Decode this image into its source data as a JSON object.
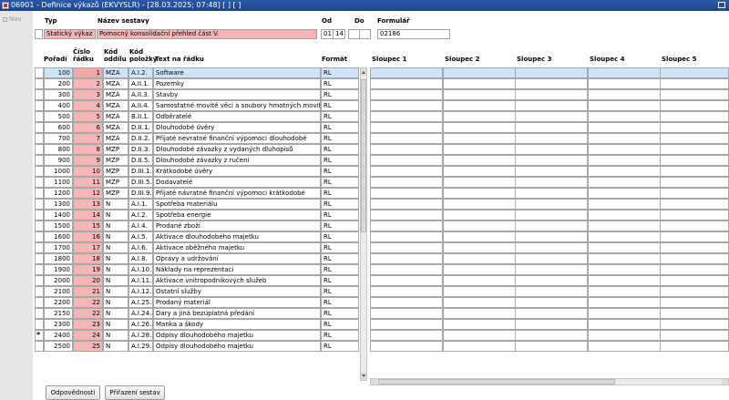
{
  "window": {
    "title": "06901 - Definice výkazů (EKVYSLR) - [28.03.2025; 07:48]  [ ]  [ ]"
  },
  "nav": {
    "label": "Nav"
  },
  "header": {
    "labels": {
      "typ": "Typ",
      "nazev": "Název sestavy",
      "od": "Od",
      "do": "Do",
      "formular": "Formulář"
    },
    "values": {
      "typ": "Statický výkaz",
      "nazev": "Pomocný konsolidační přehled část V.",
      "od_1": "01",
      "od_2": "14",
      "do": "",
      "formular": "02186"
    }
  },
  "grid": {
    "columns": {
      "poradi": "Pořadí",
      "cislo_l1": "Číslo",
      "cislo_l2": "řádku",
      "kod_oddilu_l1": "Kód",
      "kod_oddilu_l2": "oddílu",
      "kod_polozky_l1": "Kód",
      "kod_polozky_l2": "položky",
      "text": "Text na řádku",
      "format": "Formát",
      "sloupec1": "Sloupec 1",
      "sloupec2": "Sloupec 2",
      "sloupec3": "Sloupec 3",
      "sloupec4": "Sloupec 4",
      "sloupec5": "Sloupec 5"
    },
    "rows": [
      {
        "poradi": "100",
        "cislo": "1",
        "oddil": "MZA",
        "polozka": "A.I.2.",
        "text": "Software",
        "format": "RL"
      },
      {
        "poradi": "200",
        "cislo": "2",
        "oddil": "MZA",
        "polozka": "A.II.1.",
        "text": "Pozemky",
        "format": "RL"
      },
      {
        "poradi": "300",
        "cislo": "3",
        "oddil": "MZA",
        "polozka": "A.II.3.",
        "text": "Stavby",
        "format": "RL"
      },
      {
        "poradi": "400",
        "cislo": "4",
        "oddil": "MZA",
        "polozka": "A.II.4.",
        "text": "Samostatné movité věci a soubory hmotných movitých věcí",
        "format": "RL"
      },
      {
        "poradi": "500",
        "cislo": "5",
        "oddil": "MZA",
        "polozka": "B.II.1.",
        "text": "Odběratelé",
        "format": "RL"
      },
      {
        "poradi": "600",
        "cislo": "6",
        "oddil": "MZA",
        "polozka": "D.II.1.",
        "text": "Dlouhodobé úvěry",
        "format": "RL"
      },
      {
        "poradi": "700",
        "cislo": "7",
        "oddil": "MZA",
        "polozka": "D.II.2.",
        "text": "Přijaté nevratné finanční výpomoci dlouhodobé",
        "format": "RL"
      },
      {
        "poradi": "800",
        "cislo": "8",
        "oddil": "MZP",
        "polozka": "D.II.3.",
        "text": "Dlouhodobé závazky z vydaných dluhopisů",
        "format": "RL"
      },
      {
        "poradi": "900",
        "cislo": "9",
        "oddil": "MZP",
        "polozka": "D.II.5.",
        "text": "Dlouhodobé závazky z ručení",
        "format": "RL"
      },
      {
        "poradi": "1000",
        "cislo": "10",
        "oddil": "MZP",
        "polozka": "D.III.1.",
        "text": "Krátkodobé úvěry",
        "format": "RL"
      },
      {
        "poradi": "1100",
        "cislo": "11",
        "oddil": "MZP",
        "polozka": "D.III.5.",
        "text": "Dodavatelé",
        "format": "RL"
      },
      {
        "poradi": "1200",
        "cislo": "12",
        "oddil": "MZP",
        "polozka": "D.III.9.",
        "text": "Přijaté návratné finanční výpomoci krátkodobé",
        "format": "RL"
      },
      {
        "poradi": "1300",
        "cislo": "13",
        "oddil": "N",
        "polozka": "A.I.1.",
        "text": "Spotřeba materiálu",
        "format": "RL"
      },
      {
        "poradi": "1400",
        "cislo": "14",
        "oddil": "N",
        "polozka": "A.I.2.",
        "text": "Spotřeba energie",
        "format": "RL"
      },
      {
        "poradi": "1500",
        "cislo": "15",
        "oddil": "N",
        "polozka": "A.I.4.",
        "text": "Prodané zboží",
        "format": "RL"
      },
      {
        "poradi": "1600",
        "cislo": "16",
        "oddil": "N",
        "polozka": "A.I.5.",
        "text": "Aktivace dlouhodobého majetku",
        "format": "RL"
      },
      {
        "poradi": "1700",
        "cislo": "17",
        "oddil": "N",
        "polozka": "A.I.6.",
        "text": "Aktivace oběžného majetku",
        "format": "RL"
      },
      {
        "poradi": "1800",
        "cislo": "18",
        "oddil": "N",
        "polozka": "A.I.8.",
        "text": "Opravy a udržování",
        "format": "RL"
      },
      {
        "poradi": "1900",
        "cislo": "19",
        "oddil": "N",
        "polozka": "A.I.10.",
        "text": "Náklady na reprezentaci",
        "format": "RL"
      },
      {
        "poradi": "2000",
        "cislo": "20",
        "oddil": "N",
        "polozka": "A.I.11.",
        "text": "Aktivace vnitropodnikových služeb",
        "format": "RL"
      },
      {
        "poradi": "2100",
        "cislo": "21",
        "oddil": "N",
        "polozka": "A.I.12.",
        "text": "Ostatní služby",
        "format": "RL"
      },
      {
        "poradi": "2200",
        "cislo": "22",
        "oddil": "N",
        "polozka": "A.I.25.",
        "text": "Prodaný materiál",
        "format": "RL"
      },
      {
        "poradi": "2150",
        "cislo": "22",
        "oddil": "N",
        "polozka": "A.I.24.",
        "text": "Dary a jiná bezúplatná předání",
        "format": "RL"
      },
      {
        "poradi": "2300",
        "cislo": "23",
        "oddil": "N",
        "polozka": "A.I.26.",
        "text": "Manka a škody",
        "format": "RL"
      },
      {
        "poradi": "2400",
        "cislo": "24",
        "oddil": "N",
        "polozka": "A.I.28.",
        "text": "Odpisy dlouhodobého majetku",
        "format": "RL",
        "marker": "*"
      },
      {
        "poradi": "2500",
        "cislo": "25",
        "oddil": "N",
        "polozka": "A.I.29.",
        "text": "Odpisy dlouhodobého majetku",
        "format": "RL"
      }
    ]
  },
  "buttons": {
    "odpovednosti": "Odpovědnosti",
    "prirazeni": "Přiřazení sestav"
  }
}
